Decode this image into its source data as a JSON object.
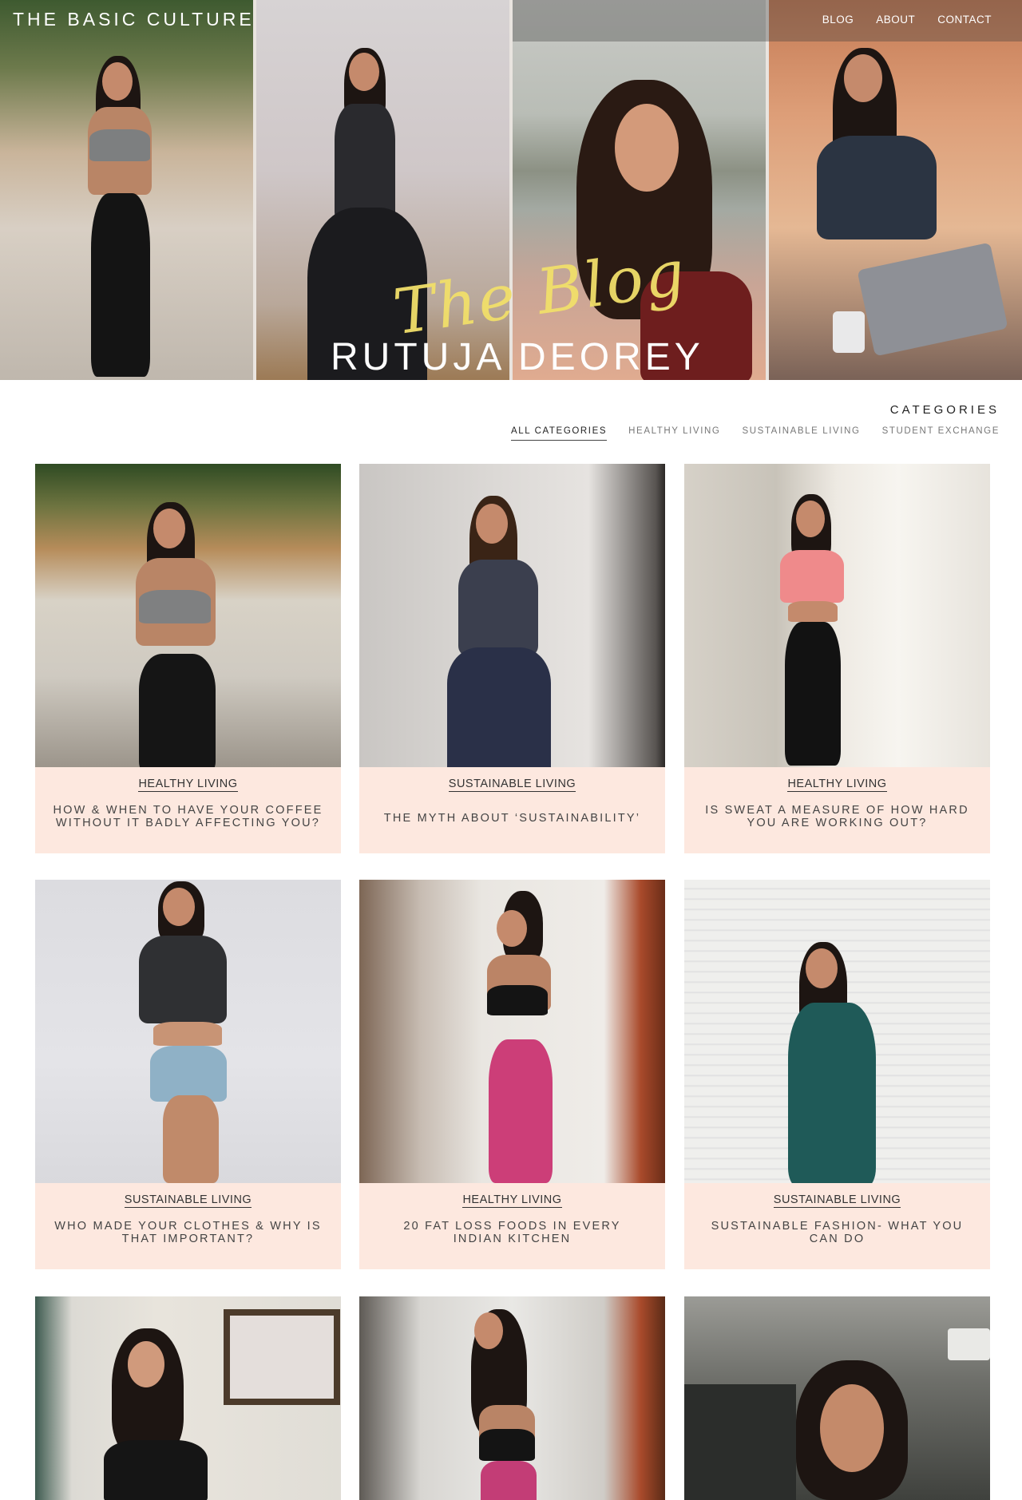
{
  "site": {
    "title": "THE BASIC CULTURE"
  },
  "nav": {
    "items": [
      "BLOG",
      "ABOUT",
      "CONTACT"
    ]
  },
  "hero": {
    "script_text": "The Blog",
    "name": "RUTUJA DEOREY"
  },
  "categories": {
    "heading": "CATEGORIES",
    "tabs": [
      "ALL CATEGORIES",
      "HEALTHY LIVING",
      "SUSTAINABLE LIVING",
      "STUDENT EXCHANGE"
    ],
    "active_tab": "ALL CATEGORIES"
  },
  "posts": [
    {
      "category": "HEALTHY LIVING",
      "title": "HOW & WHEN TO HAVE YOUR COFFEE WITHOUT IT BADLY AFFECTING YOU?"
    },
    {
      "category": "SUSTAINABLE LIVING",
      "title": "THE MYTH ABOUT ‘SUSTAINABILITY’"
    },
    {
      "category": "HEALTHY LIVING",
      "title": "IS SWEAT A MEASURE OF HOW HARD YOU ARE WORKING OUT?"
    },
    {
      "category": "SUSTAINABLE LIVING",
      "title": "WHO MADE YOUR CLOTHES & WHY IS THAT IMPORTANT?"
    },
    {
      "category": "HEALTHY LIVING",
      "title": "20 FAT LOSS FOODS IN EVERY INDIAN KITCHEN"
    },
    {
      "category": "SUSTAINABLE LIVING",
      "title": "SUSTAINABLE FASHION- WHAT YOU CAN DO"
    }
  ],
  "colors": {
    "card_background": "#fde8df",
    "script_yellow": "#f1df6a"
  }
}
